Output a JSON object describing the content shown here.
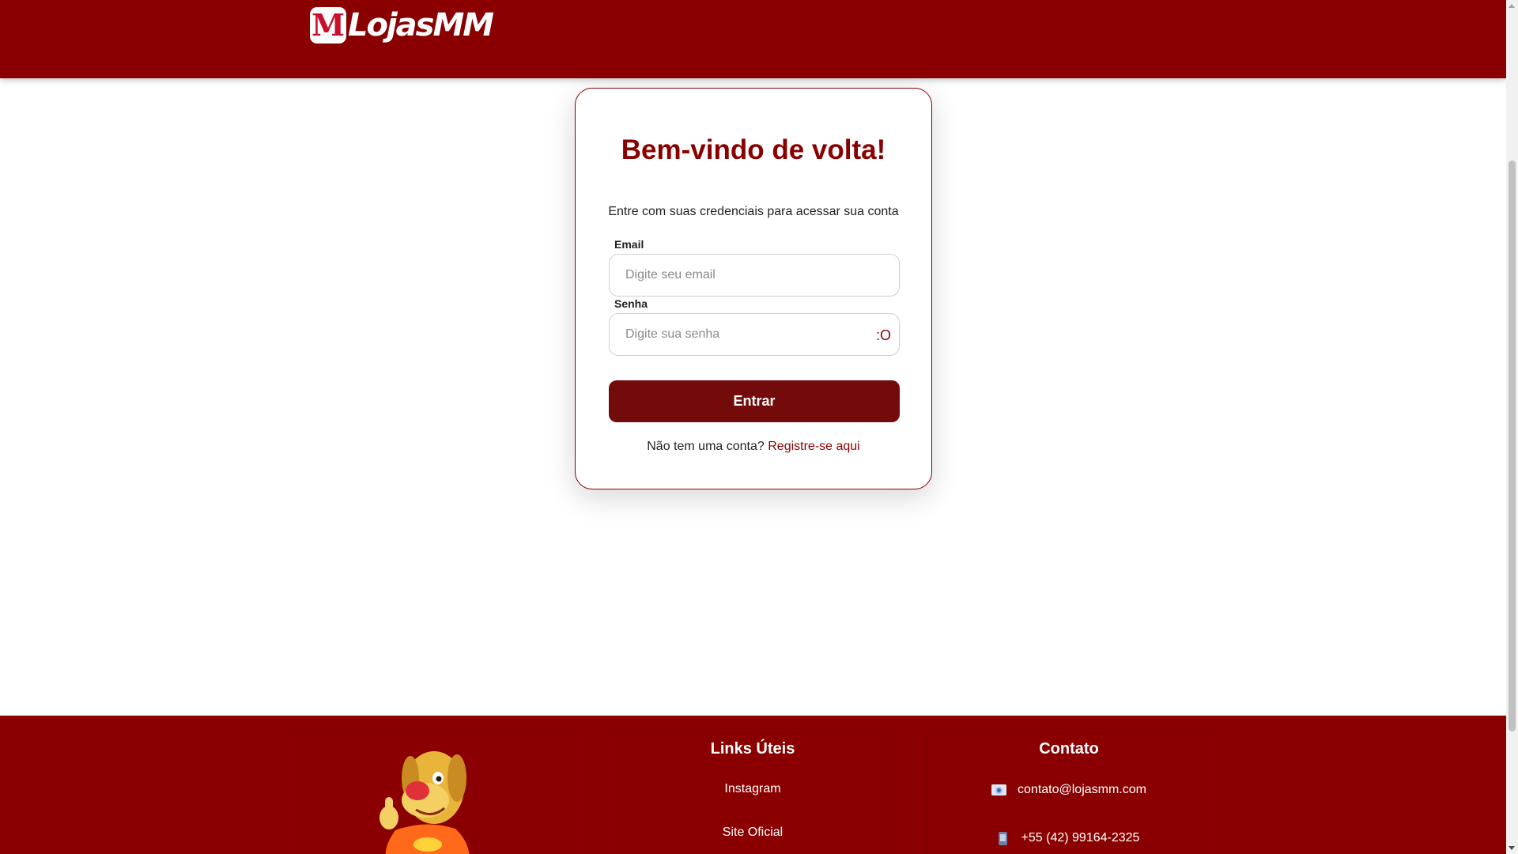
{
  "header": {
    "logo_mark": "M",
    "logo_text": "LojasMM"
  },
  "login": {
    "title": "Bem-vindo de volta!",
    "subtitle": "Entre com suas credenciais para acessar sua conta",
    "email_label": "Email",
    "email_placeholder": "Digite seu email",
    "email_value": "",
    "password_label": "Senha",
    "password_placeholder": "Digite sua senha",
    "password_value": "",
    "password_toggle": ":O",
    "submit_label": "Entrar",
    "register_prompt": "Não tem uma conta?",
    "register_link": "Registre-se aqui"
  },
  "footer": {
    "links_heading": "Links Úteis",
    "links": [
      "Instagram",
      "Site Oficial"
    ],
    "contact_heading": "Contato",
    "contact_email": "contato@lojasmm.com",
    "contact_phone": "+55 (42) 99164-2325",
    "email_icon": "email-icon",
    "phone_icon": "phone-icon",
    "mascot_image": "dog-mascot"
  },
  "colors": {
    "brand": "#8a0000",
    "button": "#740b0b",
    "white": "#ffffff"
  }
}
